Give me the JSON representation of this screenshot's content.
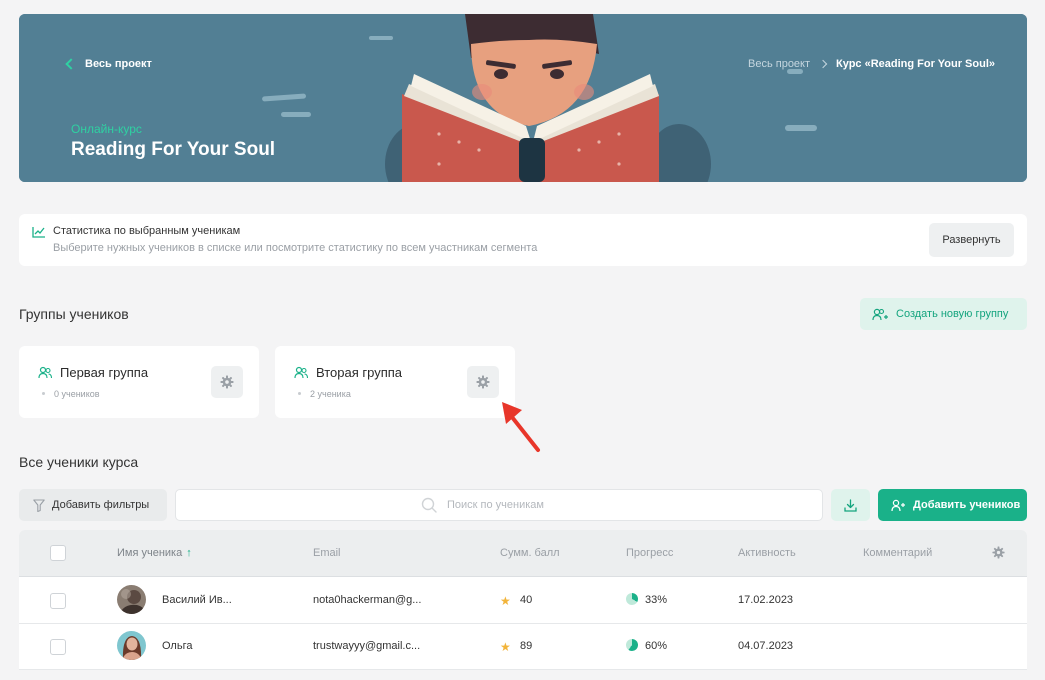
{
  "banner": {
    "back_label": "Весь проект",
    "breadcrumb": [
      "Весь проект",
      "Курс «Reading For Your Soul»"
    ],
    "course_type": "Онлайн-курс",
    "course_title": "Reading For Your Soul"
  },
  "stats": {
    "title": "Статистика по выбранным ученикам",
    "subtitle": "Выберите нужных учеников в списке или посмотрите статистику по всем участникам сегмента",
    "expand_label": "Развернуть"
  },
  "groups": {
    "heading": "Группы учеников",
    "create_label": "Создать новую группу",
    "items": [
      {
        "name": "Первая группа",
        "count": "0 учеников"
      },
      {
        "name": "Вторая группа",
        "count": "2 ученика"
      }
    ]
  },
  "students": {
    "heading": "Все ученики курса",
    "filter_label": "Добавить фильтры",
    "search_placeholder": "Поиск по ученикам",
    "add_label": "Добавить учеников",
    "columns": [
      "Имя ученика",
      "Email",
      "Сумм. балл",
      "Прогресс",
      "Активность",
      "Комментарий"
    ],
    "sort_indicator": "↑",
    "rows": [
      {
        "name": "Василий Ив...",
        "email": "nota0hackerman@g...",
        "score": "40",
        "progress": "33%",
        "progress_value": 33,
        "activity": "17.02.2023"
      },
      {
        "name": "Ольга",
        "email": "trustwayyy@gmail.c...",
        "score": "89",
        "progress": "60%",
        "progress_value": 60,
        "activity": "04.07.2023"
      }
    ]
  },
  "colors": {
    "accent": "#1ab189",
    "banner_bg": "#527f94",
    "annotation_arrow": "#e8362a"
  }
}
